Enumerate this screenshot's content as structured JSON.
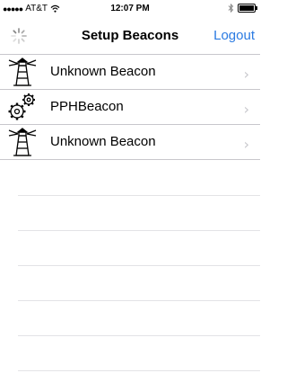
{
  "status_bar": {
    "carrier": "AT&T",
    "time": "12:07 PM"
  },
  "nav": {
    "title": "Setup Beacons",
    "logout_label": "Logout",
    "accent_color": "#2a7ae2"
  },
  "beacons": [
    {
      "label": "Unknown Beacon",
      "icon": "lighthouse-icon"
    },
    {
      "label": "PPHBeacon",
      "icon": "gears-icon"
    },
    {
      "label": "Unknown Beacon",
      "icon": "lighthouse-icon"
    }
  ],
  "chevron_glyph": "›"
}
